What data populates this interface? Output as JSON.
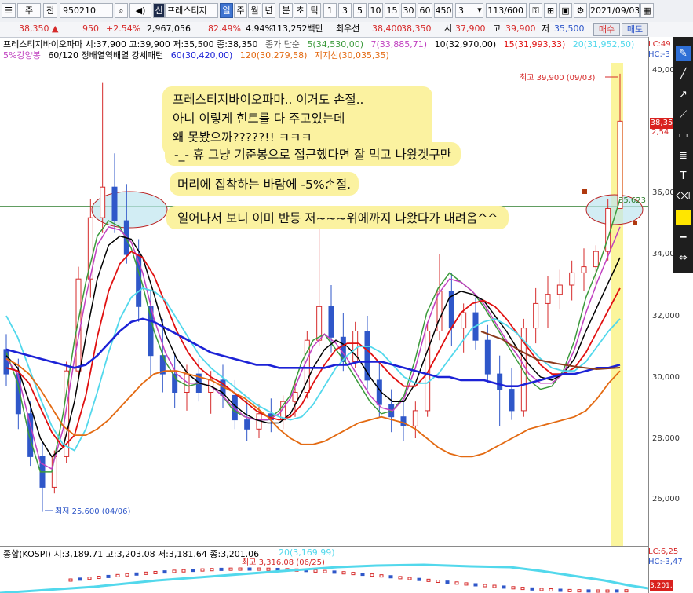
{
  "toolbar": {
    "items": [
      "주",
      "전",
      "950210",
      "신",
      "프레스티지",
      "일",
      "주",
      "월",
      "년",
      "분",
      "초",
      "틱",
      "1",
      "3",
      "5",
      "10",
      "15",
      "30",
      "60",
      "450",
      "3",
      "113/600",
      "2021/09/03"
    ]
  },
  "quote": {
    "price": "38,350",
    "change_arrow": "▲",
    "change": "950",
    "change_pct": "+2.54%",
    "volume": "2,967,056",
    "turnover_ratio": "82.49%",
    "volume_pct": "4.94%",
    "amount": "113,252백만",
    "best_label": "최우선",
    "best_bid": "38,400",
    "best_ask": "38,350",
    "open_label": "시",
    "open": "37,900",
    "high_label": "고",
    "high": "39,900",
    "low_label": "저",
    "low": "35,500",
    "buy_label": "매수",
    "sell_label": "매도"
  },
  "legend": {
    "line1_title": "프레스티지바이오파마 시:37,900 고:39,900 저:35,500 종:38,350",
    "ma_label": "종가 단순",
    "ma5": "5(34,530,00)",
    "ma7": "7(33,885,71)",
    "ma10": "10(32,970,00)",
    "ma15": "15(31,993,33)",
    "ma20": "20(31,952,50)",
    "line2_prefix": "5%강양봉",
    "line2_title": "60/120 정배열역배열 강세패턴",
    "ma60": "60(30,420,00)",
    "ma120": "120(30,279,58)",
    "support": "지지선(30,035,35)"
  },
  "right_labels": {
    "lc": "LC:49",
    "hc": "HC:-3",
    "lc2": "LC:6,25",
    "hc2": "HC:-3,47",
    "price_box": "38,35",
    "pct_box": "2,54",
    "kospi_box": "3,201,06"
  },
  "annotations": {
    "high_label": "최고 39,900 (09/03)",
    "low_label": "최저 25,600 (04/06)",
    "level_label": "35,623",
    "note1": "프레스티지바이오파마.. 이거도 손절..",
    "note2": "아니 이렇게 힌트를 다 주고있는데",
    "note3": "왜 못봤으까?????!! ㅋㅋㅋ",
    "note4": "-_- 휴 그냥 기준봉으로 접근했다면 잘 먹고 나왔겟구만",
    "note5": "머리에 집착하는 바람에 -5%손절.",
    "note6": "일어나서 보니 이미 반등 저~~~위에까지 나왔다가 내려옴^^"
  },
  "sub": {
    "title": "종합(KOSPI) 시:3,189.71 고:3,203.08 저:3,181.64 종:3,201.06",
    "ma": "20(3,169.99)",
    "high_label": "최고 3,316.08 (06/25)"
  },
  "colors": {
    "up": "#d62a2a",
    "down": "#2f57c9",
    "ma5": "#3b9a3b",
    "ma7": "#c040c0",
    "ma10": "#000000",
    "ma15": "#e01010",
    "ma20": "#52d8ec",
    "ma60": "#1c22d6",
    "ma120": "#e36a12",
    "brown": "#8b3a1c",
    "hline": "#2d7d2d"
  },
  "chart_data": {
    "type": "line",
    "title": "프레스티지바이오파마",
    "y_ticks": [
      "40,000",
      "38,000",
      "36,000",
      "34,000",
      "32,000",
      "30,000",
      "28,000",
      "26,000"
    ],
    "ylim": [
      24800,
      40400
    ],
    "horizontal_line": 35623,
    "series": [
      {
        "name": "5",
        "values": [
          30800,
          29800,
          28100,
          26900,
          26900,
          28800,
          31200,
          33100,
          34600,
          35100,
          34900,
          34200,
          33000,
          31500,
          30500,
          29900,
          29700,
          29800,
          29700,
          29400,
          28900,
          28700,
          28600,
          28600,
          28900,
          29400,
          30500,
          31200,
          31400,
          30900,
          30400,
          29800,
          29200,
          28800,
          28900,
          29400,
          30600,
          32100,
          32900,
          33400,
          33100,
          32800,
          32300,
          31700,
          31100,
          30500,
          29900,
          29600,
          29700,
          30200,
          31200,
          32600,
          33500,
          34600,
          35800
        ]
      },
      {
        "name": "7",
        "values": [
          30600,
          30100,
          28600,
          27200,
          27000,
          28300,
          30600,
          32600,
          34300,
          34900,
          34800,
          34400,
          33400,
          31900,
          30800,
          30100,
          29800,
          29800,
          29700,
          29400,
          29000,
          28700,
          28600,
          28600,
          28800,
          29300,
          30200,
          31000,
          31400,
          31100,
          30600,
          30000,
          29400,
          29000,
          28900,
          29300,
          30300,
          31700,
          32700,
          33200,
          33100,
          32800,
          32400,
          31800,
          31200,
          30700,
          30100,
          29800,
          29800,
          30100,
          30900,
          32100,
          33100,
          34000,
          34900
        ]
      },
      {
        "name": "10",
        "values": [
          30700,
          30300,
          29200,
          28000,
          27400,
          27700,
          29200,
          31300,
          33200,
          34300,
          34600,
          34500,
          33900,
          32700,
          31400,
          30600,
          30100,
          29800,
          29700,
          29500,
          29100,
          28800,
          28600,
          28500,
          28500,
          28800,
          29500,
          30300,
          30900,
          31200,
          31000,
          30600,
          30000,
          29500,
          29200,
          29200,
          29800,
          30800,
          31800,
          32600,
          32800,
          32700,
          32500,
          32000,
          31500,
          30900,
          30400,
          30000,
          29900,
          30100,
          30600,
          31500,
          32300,
          33100,
          33900
        ]
      },
      {
        "name": "15",
        "values": [
          30300,
          30200,
          29800,
          29000,
          28200,
          27700,
          28100,
          29400,
          31300,
          32800,
          33700,
          34100,
          33900,
          33300,
          32400,
          31500,
          30800,
          30300,
          30000,
          29800,
          29500,
          29200,
          28900,
          28700,
          28600,
          28700,
          29100,
          29800,
          30400,
          30900,
          31100,
          31100,
          30800,
          30400,
          30000,
          29700,
          29700,
          30100,
          30800,
          31500,
          32100,
          32400,
          32500,
          32300,
          31900,
          31400,
          30900,
          30400,
          30100,
          30100,
          30300,
          30800,
          31500,
          32200,
          32900
        ]
      },
      {
        "name": "20",
        "values": [
          32000,
          31300,
          30300,
          29300,
          28400,
          27800,
          27600,
          28300,
          29500,
          30800,
          31900,
          32600,
          32900,
          32800,
          32500,
          31900,
          31300,
          30700,
          30300,
          30000,
          29700,
          29400,
          29100,
          28900,
          28700,
          28600,
          28700,
          29100,
          29700,
          30300,
          30700,
          31000,
          31000,
          30800,
          30400,
          30000,
          29800,
          29800,
          30100,
          30600,
          31100,
          31600,
          31800,
          31900,
          31700,
          31400,
          31000,
          30600,
          30300,
          30200,
          30200,
          30500,
          31000,
          31500,
          31900
        ]
      },
      {
        "name": "60",
        "values": [
          30900,
          30800,
          30700,
          30600,
          30500,
          30400,
          30300,
          30400,
          30700,
          31100,
          31500,
          31800,
          31900,
          31800,
          31600,
          31400,
          31200,
          31000,
          30800,
          30700,
          30600,
          30500,
          30400,
          30400,
          30300,
          30300,
          30300,
          30300,
          30300,
          30400,
          30400,
          30500,
          30500,
          30500,
          30400,
          30300,
          30200,
          30100,
          30000,
          30000,
          29900,
          29900,
          29900,
          29800,
          29700,
          29700,
          29800,
          29900,
          30000,
          30100,
          30100,
          30200,
          30300,
          30300,
          30400
        ]
      },
      {
        "name": "120",
        "values": [
          30600,
          30400,
          30100,
          29600,
          29000,
          28400,
          28100,
          28100,
          28300,
          28600,
          29000,
          29400,
          29800,
          30100,
          30200,
          30200,
          30100,
          30000,
          29900,
          29700,
          29500,
          29300,
          29000,
          28700,
          28300,
          28000,
          27800,
          27800,
          27900,
          28100,
          28300,
          28500,
          28600,
          28700,
          28600,
          28500,
          28300,
          28000,
          27700,
          27500,
          27400,
          27400,
          27500,
          27700,
          27900,
          28100,
          28300,
          28400,
          28500,
          28600,
          28700,
          28900,
          29300,
          29800,
          30200
        ]
      }
    ],
    "candles": [
      [
        30900,
        31400,
        29700,
        30100
      ],
      [
        30100,
        30600,
        28300,
        28800
      ],
      [
        28800,
        29200,
        27100,
        27400
      ],
      [
        27400,
        27900,
        25600,
        26400
      ],
      [
        26400,
        27600,
        26200,
        27400
      ],
      [
        27400,
        30500,
        27200,
        30200
      ],
      [
        30200,
        33600,
        29900,
        33200
      ],
      [
        33200,
        35800,
        32600,
        35200
      ],
      [
        35200,
        39600,
        34700,
        36200
      ],
      [
        36200,
        37300,
        34700,
        35100
      ],
      [
        35100,
        36300,
        33700,
        34000
      ],
      [
        34000,
        34500,
        31800,
        32300
      ],
      [
        32300,
        32800,
        30000,
        30700
      ],
      [
        30700,
        31900,
        29500,
        30100
      ],
      [
        30100,
        30800,
        29000,
        29500
      ],
      [
        29500,
        30400,
        28900,
        30100
      ],
      [
        30100,
        30600,
        29200,
        29500
      ],
      [
        29500,
        30200,
        28800,
        29900
      ],
      [
        29900,
        30400,
        29000,
        29400
      ],
      [
        29400,
        29900,
        28300,
        28600
      ],
      [
        28600,
        29200,
        27900,
        28300
      ],
      [
        28300,
        29100,
        28000,
        28800
      ],
      [
        28800,
        29300,
        28200,
        28600
      ],
      [
        28600,
        29400,
        28300,
        29200
      ],
      [
        29200,
        29900,
        28700,
        29500
      ],
      [
        29500,
        31500,
        29300,
        31200
      ],
      [
        31200,
        35300,
        31000,
        32300
      ],
      [
        32300,
        33000,
        30800,
        31300
      ],
      [
        31300,
        32100,
        30200,
        30500
      ],
      [
        30500,
        31800,
        30300,
        31500
      ],
      [
        31500,
        32000,
        29600,
        29900
      ],
      [
        29900,
        30500,
        28700,
        29100
      ],
      [
        29100,
        29600,
        28200,
        28700
      ],
      [
        28700,
        29300,
        27900,
        28400
      ],
      [
        28400,
        29200,
        28000,
        28900
      ],
      [
        28900,
        31800,
        28700,
        31500
      ],
      [
        31500,
        34000,
        31200,
        32800
      ],
      [
        32800,
        33400,
        31000,
        31600
      ],
      [
        31600,
        32400,
        30800,
        32100
      ],
      [
        32100,
        32600,
        30900,
        31200
      ],
      [
        31200,
        31700,
        29800,
        30100
      ],
      [
        30100,
        30700,
        28400,
        29600
      ],
      [
        29600,
        30300,
        28600,
        28900
      ],
      [
        28900,
        31900,
        28700,
        31600
      ],
      [
        31600,
        32900,
        31100,
        32400
      ],
      [
        32400,
        33300,
        31600,
        32700
      ],
      [
        32700,
        33500,
        32200,
        33000
      ],
      [
        33000,
        33800,
        32500,
        33400
      ],
      [
        33400,
        34200,
        32800,
        33600
      ],
      [
        33600,
        34300,
        33000,
        34100
      ],
      [
        34100,
        35800,
        33800,
        35500
      ],
      [
        35500,
        39900,
        35500,
        38350
      ]
    ]
  }
}
